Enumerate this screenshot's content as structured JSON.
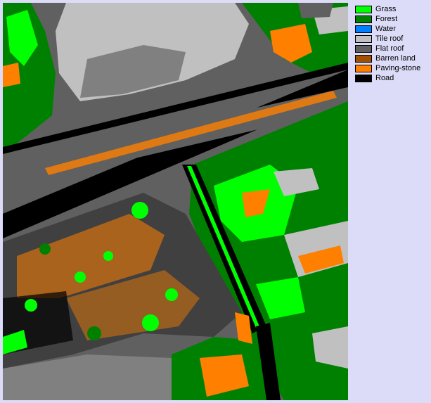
{
  "legend": {
    "items": [
      {
        "label": "Grass",
        "color": "#00ff00"
      },
      {
        "label": "Forest",
        "color": "#008000"
      },
      {
        "label": "Water",
        "color": "#0080ff"
      },
      {
        "label": "Tile roof",
        "color": "#c0c0c0"
      },
      {
        "label": "Flat roof",
        "color": "#606060"
      },
      {
        "label": "Barren land",
        "color": "#a05000"
      },
      {
        "label": "Paving-stone",
        "color": "#ff8000"
      },
      {
        "label": "Road",
        "color": "#000000"
      }
    ]
  }
}
